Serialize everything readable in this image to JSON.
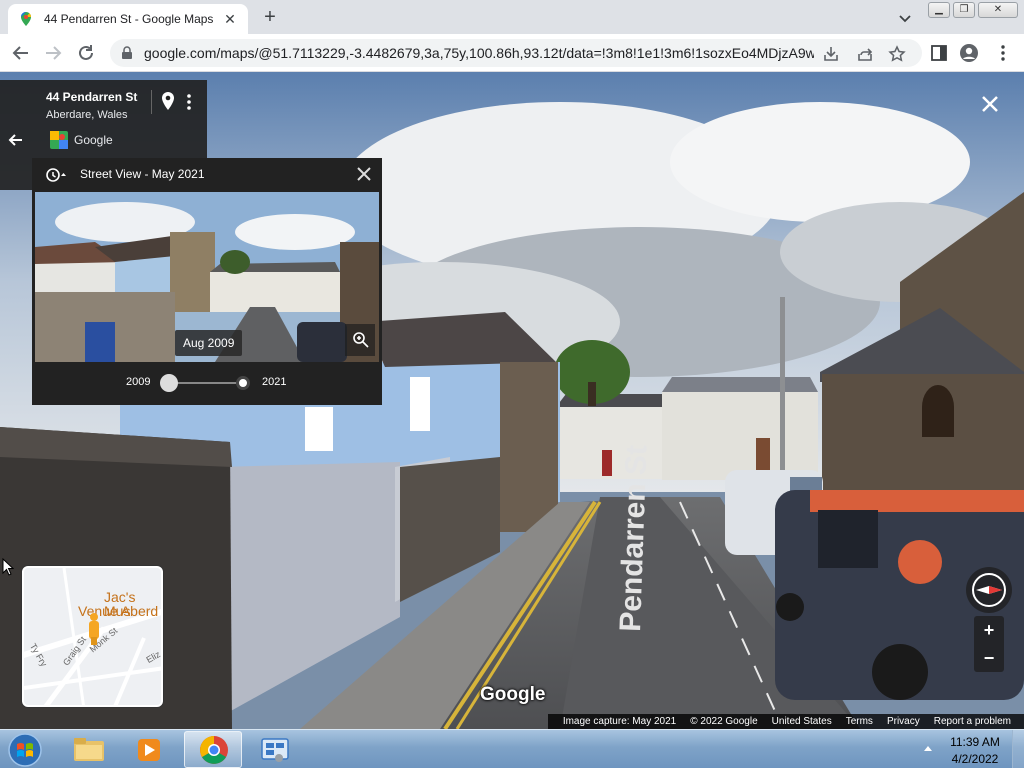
{
  "browser": {
    "tab_title": "44 Pendarren St - Google Maps",
    "url": "google.com/maps/@51.7113229,-3.4482679,3a,75y,100.86h,93.12t/data=!3m8!1e1!3m6!1sozxEo4MDjzA9w..."
  },
  "place": {
    "name": "44 Pendarren St",
    "subtitle": "Aberdare, Wales",
    "source": "Google"
  },
  "time_panel": {
    "title": "Street View - May 2021",
    "preview_date": "Aug 2009",
    "slider_start": "2009",
    "slider_end": "2021",
    "selected_position": 0.0
  },
  "minimap": {
    "poi_line1": "Jac's Mus",
    "poi_line2": "Venue Aberd",
    "streets": [
      "Monk St",
      "Graig St",
      "Ty Fry",
      "Eliz"
    ]
  },
  "scene": {
    "road_marking": "Pendarren St",
    "watermark": "Google"
  },
  "footer": {
    "items": [
      "Image capture: May 2021",
      "© 2022 Google",
      "United States",
      "Terms",
      "Privacy",
      "Report a problem"
    ]
  },
  "taskbar": {
    "time": "11:39 AM",
    "date": "4/2/2022"
  }
}
